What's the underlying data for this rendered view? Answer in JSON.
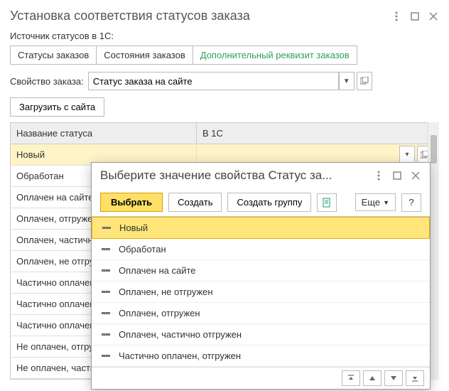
{
  "window": {
    "title": "Установка соответствия статусов заказа"
  },
  "source_label": "Источник статусов в 1С:",
  "tabs": [
    "Статусы заказов",
    "Состояния заказов",
    "Дополнительный реквизит заказов"
  ],
  "property": {
    "label": "Свойство заказа:",
    "value": "Статус заказа на сайте"
  },
  "load_btn": "Загрузить с сайта",
  "table": {
    "headers": [
      "Название статуса",
      "В 1С"
    ],
    "rows": [
      "Новый",
      "Обработан",
      "Оплачен на сайте",
      "Оплачен, отгружен",
      "Оплачен, частично отгружен",
      "Оплачен, не отгружен",
      "Частично оплачен, отгружен",
      "Частично оплачен, частично отгружен",
      "Частично оплачен, не отгружен",
      "Не оплачен, отгружен",
      "Не оплачен, частично отгружен"
    ]
  },
  "modal": {
    "title": "Выберите значение свойства Статус за...",
    "select_btn": "Выбрать",
    "create_btn": "Создать",
    "create_group_btn": "Создать группу",
    "more_btn": "Еще",
    "help_btn": "?",
    "items": [
      "Новый",
      "Обработан",
      "Оплачен на сайте",
      "Оплачен, не отгружен",
      "Оплачен, отгружен",
      "Оплачен, частично отгружен",
      "Частично оплачен, отгружен"
    ]
  }
}
